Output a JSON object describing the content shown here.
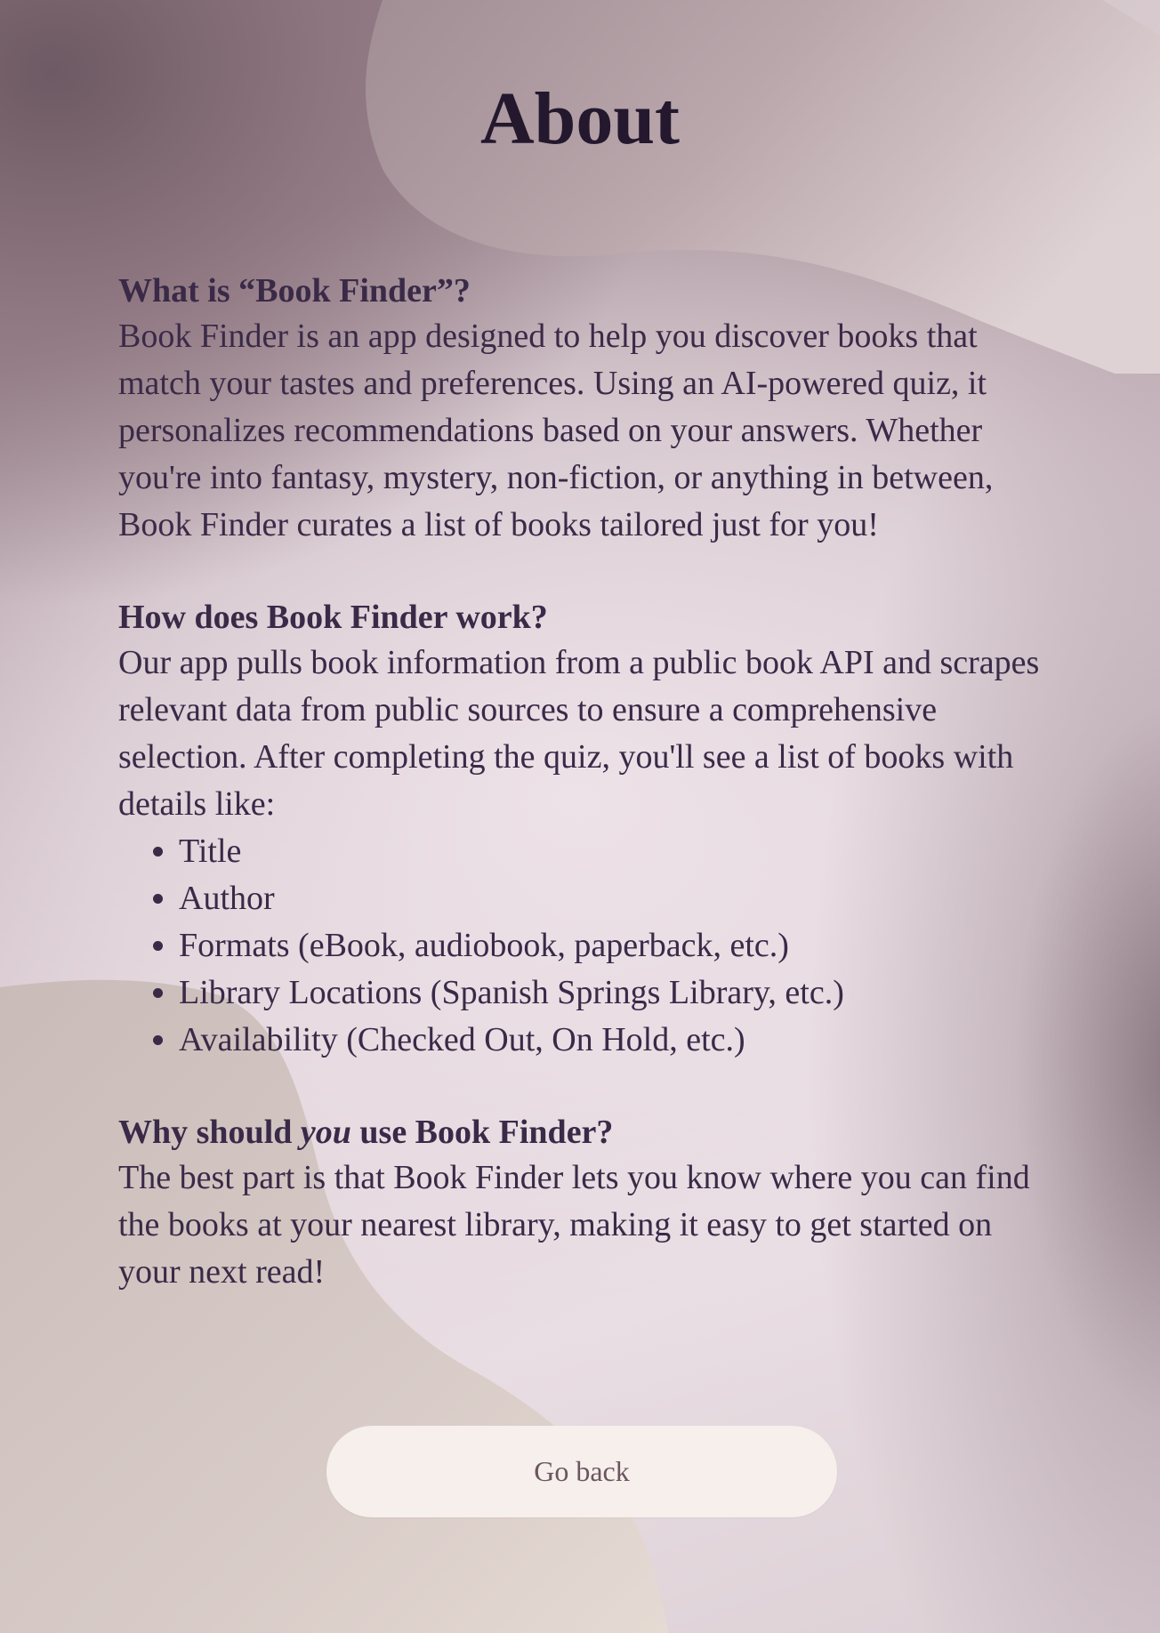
{
  "page": {
    "title": "About"
  },
  "sections": [
    {
      "heading_prefix": "What is “Book Finder”?",
      "body": "Book Finder is an app designed to help you discover books that match your tastes and preferences. Using an AI-powered quiz, it personalizes recommendations based on your answers. Whether you're into fantasy, mystery, non-fiction, or anything in between, Book Finder curates a list of books tailored just for you!"
    },
    {
      "heading_prefix": "How does Book Finder work?",
      "body": "Our app pulls book information from a public book API and scrapes relevant data from public sources to ensure a comprehensive selection. After completing the quiz, you'll see a list of books with details like:",
      "list": [
        "Title",
        "Author",
        "Formats (eBook, audiobook, paperback, etc.)",
        "Library Locations (Spanish Springs Library, etc.)",
        "Availability (Checked Out, On Hold, etc.)"
      ]
    },
    {
      "heading_prefix": "Why should ",
      "heading_emphasis": "you",
      "heading_suffix": " use Book Finder?",
      "body": "The best part is that Book Finder lets you know where you can find the books at your nearest library, making it easy to get started on your next read!"
    }
  ],
  "go_back_button": {
    "label": "Go back"
  },
  "colors": {
    "text": "#3a2a48",
    "title": "#24182e",
    "button_bg": "#f6efeb",
    "button_text": "#6a5560"
  }
}
